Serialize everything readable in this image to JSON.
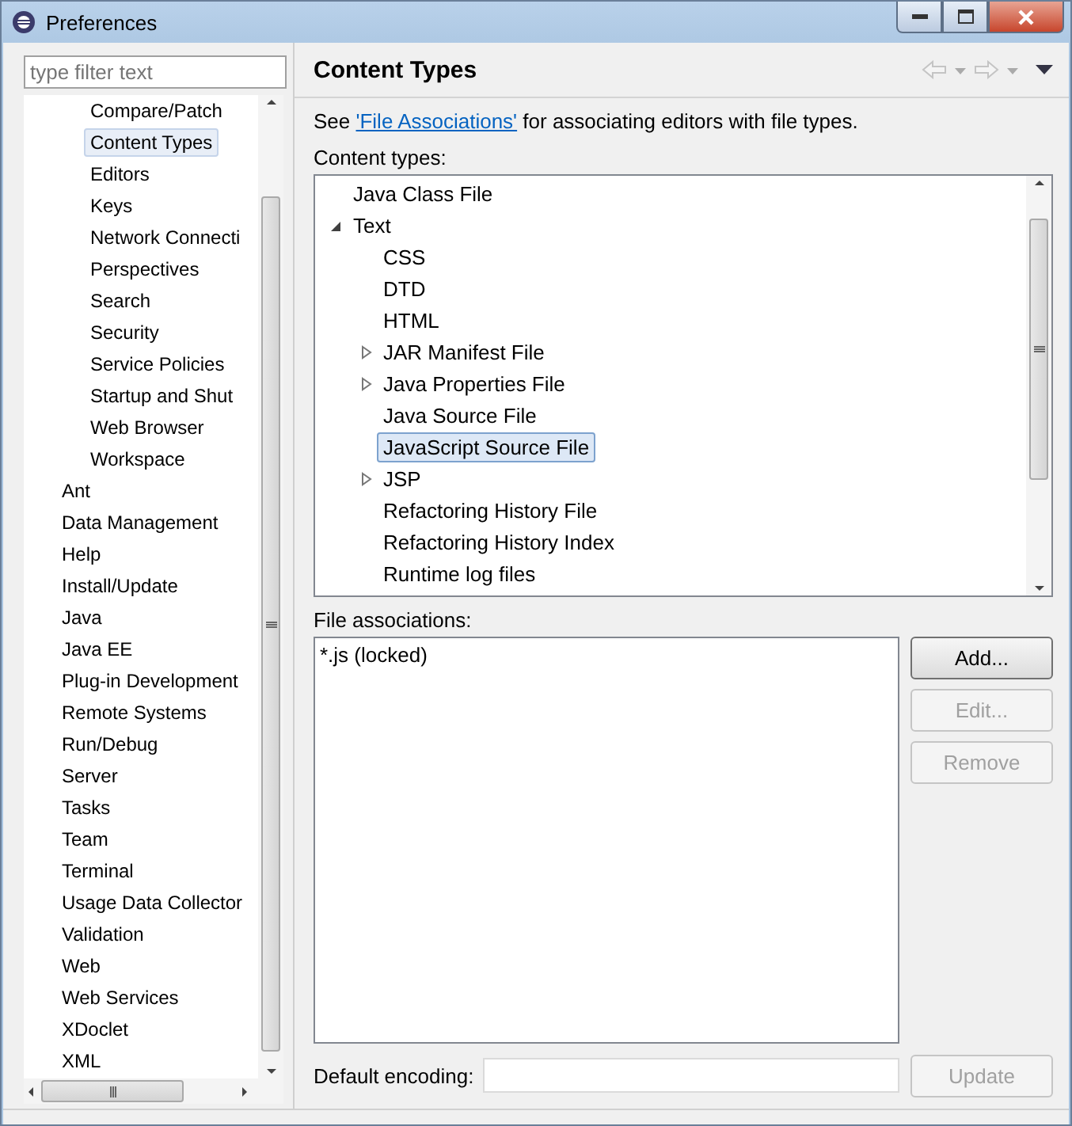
{
  "window": {
    "title": "Preferences"
  },
  "filter": {
    "placeholder": "type filter text"
  },
  "nav_tree": [
    {
      "children": [
        {
          "label": "Compare/Patch",
          "selected": false
        },
        {
          "label": "Content Types",
          "selected": true
        },
        {
          "label": "Editors",
          "selected": false
        },
        {
          "label": "Keys",
          "selected": false
        },
        {
          "label": "Network Connecti",
          "selected": false
        },
        {
          "label": "Perspectives",
          "selected": false
        },
        {
          "label": "Search",
          "selected": false
        },
        {
          "label": "Security",
          "selected": false
        },
        {
          "label": "Service Policies",
          "selected": false
        },
        {
          "label": "Startup and Shut",
          "selected": false
        },
        {
          "label": "Web Browser",
          "selected": false
        },
        {
          "label": "Workspace",
          "selected": false
        }
      ]
    },
    {
      "label": "Ant",
      "selected": false
    },
    {
      "label": "Data Management",
      "selected": false
    },
    {
      "label": "Help",
      "selected": false
    },
    {
      "label": "Install/Update",
      "selected": false
    },
    {
      "label": "Java",
      "selected": false
    },
    {
      "label": "Java EE",
      "selected": false
    },
    {
      "label": "Plug-in Development",
      "selected": false
    },
    {
      "label": "Remote Systems",
      "selected": false
    },
    {
      "label": "Run/Debug",
      "selected": false
    },
    {
      "label": "Server",
      "selected": false
    },
    {
      "label": "Tasks",
      "selected": false
    },
    {
      "label": "Team",
      "selected": false
    },
    {
      "label": "Terminal",
      "selected": false
    },
    {
      "label": "Usage Data Collector",
      "selected": false
    },
    {
      "label": "Validation",
      "selected": false
    },
    {
      "label": "Web",
      "selected": false
    },
    {
      "label": "Web Services",
      "selected": false
    },
    {
      "label": "XDoclet",
      "selected": false
    },
    {
      "label": "XML",
      "selected": false
    }
  ],
  "page": {
    "title": "Content Types",
    "intro": {
      "before": "See ",
      "link": "'File Associations'",
      "after": " for associating editors with file types."
    },
    "content_types_label": "Content types:",
    "content_types": [
      {
        "label": "Java Class File",
        "selected": false
      },
      {
        "label": "Text",
        "selected": false,
        "expanded": true,
        "children": [
          {
            "label": "CSS",
            "selected": false
          },
          {
            "label": "DTD",
            "selected": false
          },
          {
            "label": "HTML",
            "selected": false
          },
          {
            "label": "JAR Manifest File",
            "selected": false,
            "expanded": false
          },
          {
            "label": "Java Properties File",
            "selected": false,
            "expanded": false
          },
          {
            "label": "Java Source File",
            "selected": false
          },
          {
            "label": "JavaScript Source File",
            "selected": true
          },
          {
            "label": "JSP",
            "selected": false,
            "expanded": false
          },
          {
            "label": "Refactoring History File",
            "selected": false
          },
          {
            "label": "Refactoring History Index",
            "selected": false
          },
          {
            "label": "Runtime log files",
            "selected": false
          }
        ]
      }
    ],
    "file_associations_label": "File associations:",
    "file_associations": [
      "*.js (locked)"
    ],
    "buttons": [
      {
        "label": "Add...",
        "disabled": false
      },
      {
        "label": "Edit...",
        "disabled": true
      },
      {
        "label": "Remove",
        "disabled": true
      }
    ],
    "encoding": {
      "label": "Default encoding:",
      "button": {
        "label": "Update",
        "disabled": true
      }
    }
  }
}
